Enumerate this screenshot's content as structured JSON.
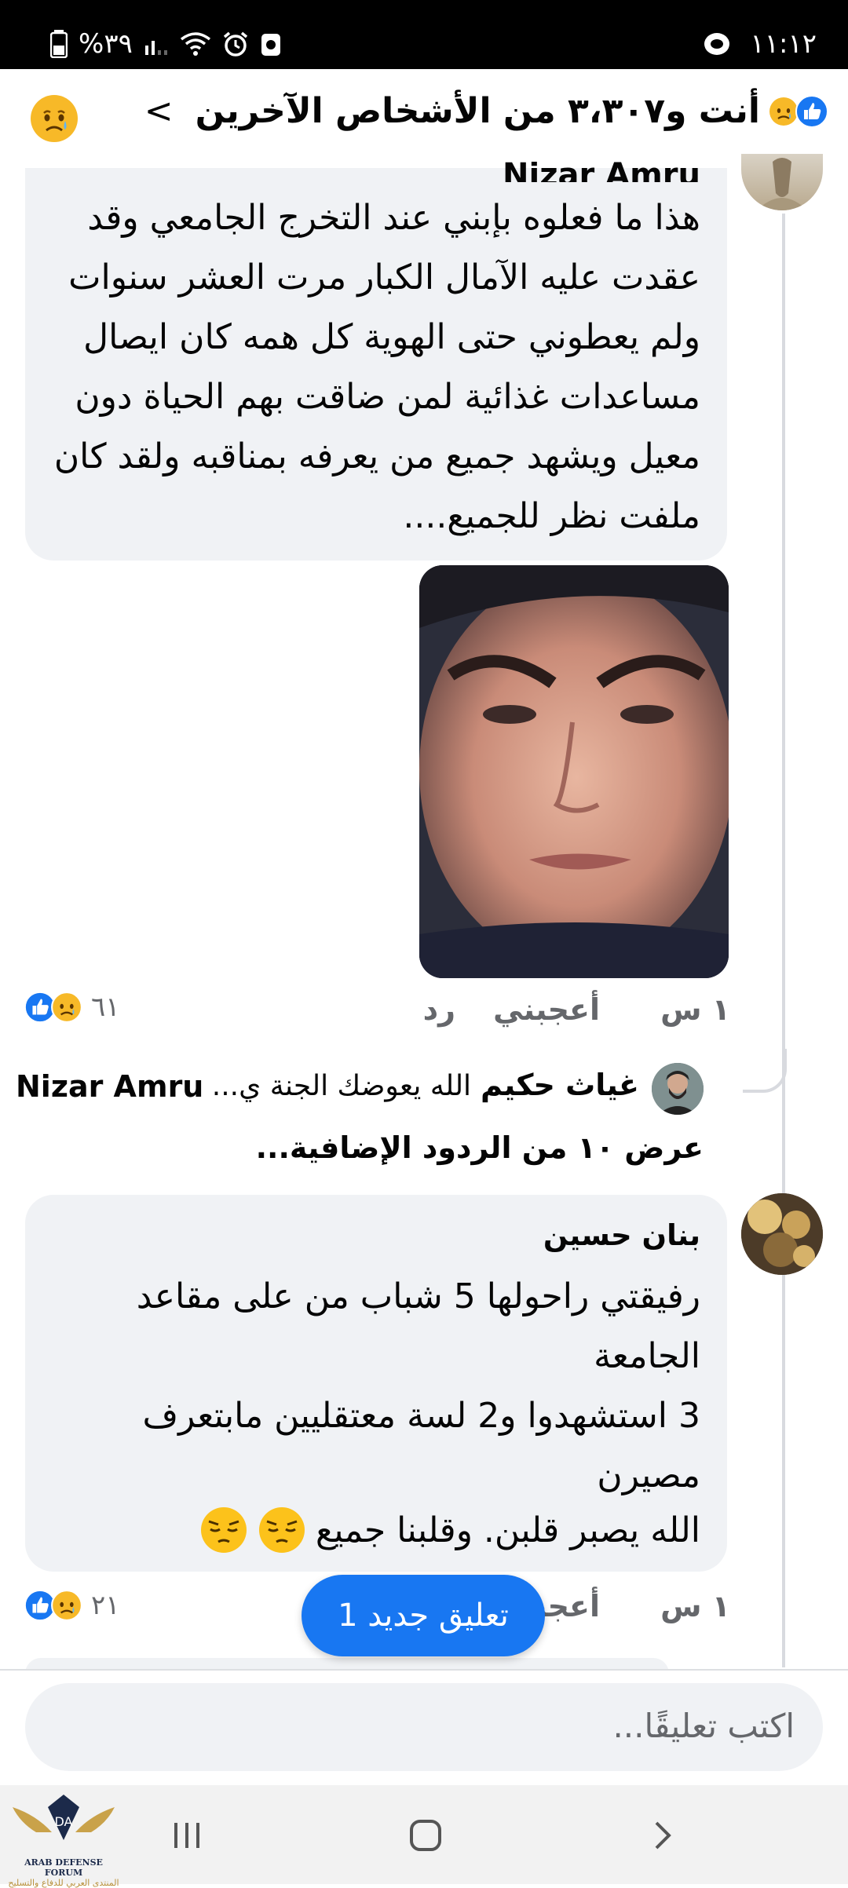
{
  "status_bar": {
    "time": "١١:١٢",
    "battery_percent": "%٣٩"
  },
  "header": {
    "title": "أنت و٣،٣٠٧ من الأشخاص الآخرين",
    "chevron": "<"
  },
  "comment1": {
    "author": "Nizar Amru",
    "text": "هذا ما فعلوه بإبني عند التخرج الجامعي وقد عقدت عليه الآمال الكبار مرت العشر سنوات ولم يعطوني حتى الهوية كل همه كان ايصال مساعدات غذائية لمن ضاقت بهم الحياة دون معيل ويشهد جميع من يعرفه بمناقبه ولقد كان ملفت نظر للجميع....",
    "time": "١ س",
    "like_label": "أعجبني",
    "reply_label": "رد",
    "reaction_count": "٦١"
  },
  "reply_preview": {
    "author": "غياث حكيم",
    "text": "الله يعوضك الجنة ي...",
    "mention": "Nizar Amru"
  },
  "more_replies": "عرض ١٠ من الردود الإضافية...",
  "comment2": {
    "author": "بنان حسين",
    "line1": "رفيقتي راحولها 5 شباب من على مقاعد الجامعة",
    "line2": "3 استشهدوا و2 لسة معتقليين مابتعرف مصيرن",
    "line3": "الله يصبر قلبن. وقلبنا جميع",
    "time": "١ س",
    "like_label": "أعجبني",
    "reaction_count": "٢١"
  },
  "new_comment_pill": "1 تعليق جديد",
  "composer": {
    "placeholder": "اكتب تعليقًا..."
  },
  "watermark": {
    "line1": "ARAB DEFENSE FORUM",
    "line2": "المنتدى العربي للدفاع والتسليح"
  },
  "colors": {
    "accent": "#1877f2",
    "bubble": "#f0f2f5",
    "secondary_text": "#65676b"
  }
}
